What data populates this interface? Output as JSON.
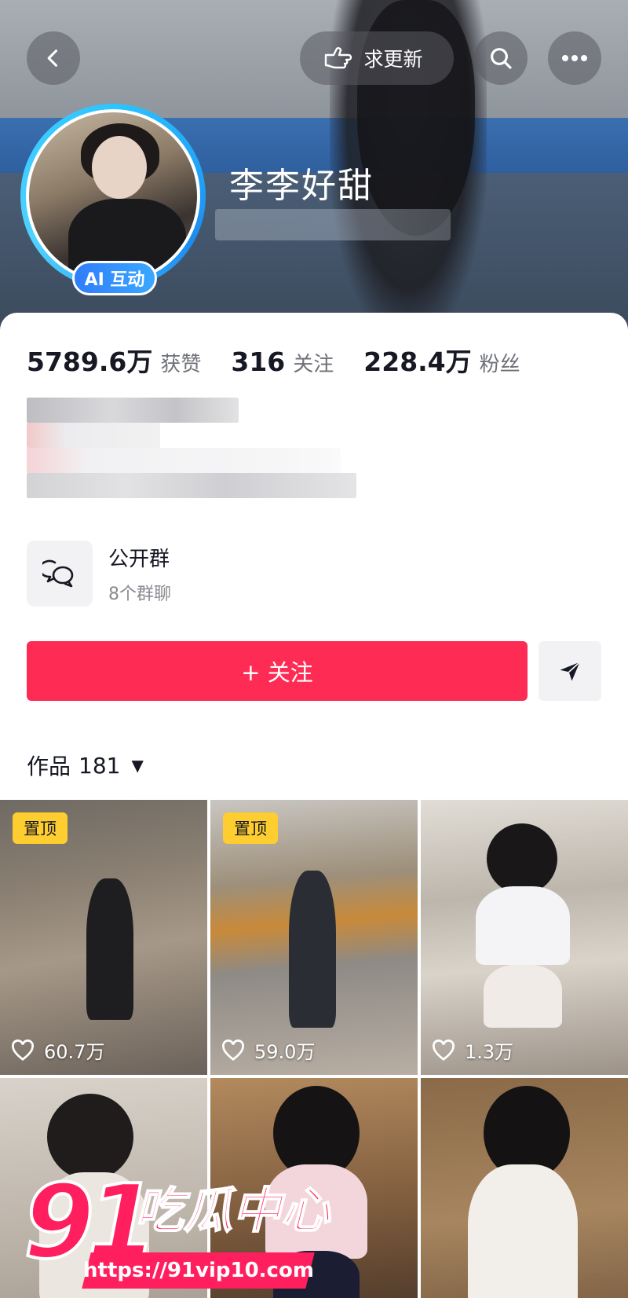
{
  "header": {
    "request_update_label": "求更新",
    "nickname": "李李好甜",
    "ai_badge": "AI 互动",
    "icons": [
      "back-icon",
      "hand-point-icon",
      "search-icon",
      "more-icon"
    ]
  },
  "stats": [
    {
      "value": "5789.6万",
      "label": "获赞"
    },
    {
      "value": "316",
      "label": "关注"
    },
    {
      "value": "228.4万",
      "label": "粉丝"
    }
  ],
  "group": {
    "title": "公开群",
    "subtitle": "8个群聊"
  },
  "actions": {
    "follow_label": "+ 关注"
  },
  "works": {
    "label": "作品",
    "count": "181"
  },
  "grid": [
    {
      "pinned": "置顶",
      "likes": "60.7万"
    },
    {
      "pinned": "置顶",
      "likes": "59.0万"
    },
    {
      "pinned": "",
      "likes": "1.3万"
    },
    {
      "pinned": "",
      "likes": ""
    },
    {
      "pinned": "",
      "likes": ""
    },
    {
      "pinned": "",
      "likes": ""
    }
  ],
  "watermark": {
    "number": "91",
    "text": "吃瓜中心",
    "url": "https://91vip10.com"
  },
  "colors": {
    "follow": "#fe2c55",
    "pin_badge": "#fecd2f",
    "ai_badge": "#2f7dfb"
  }
}
